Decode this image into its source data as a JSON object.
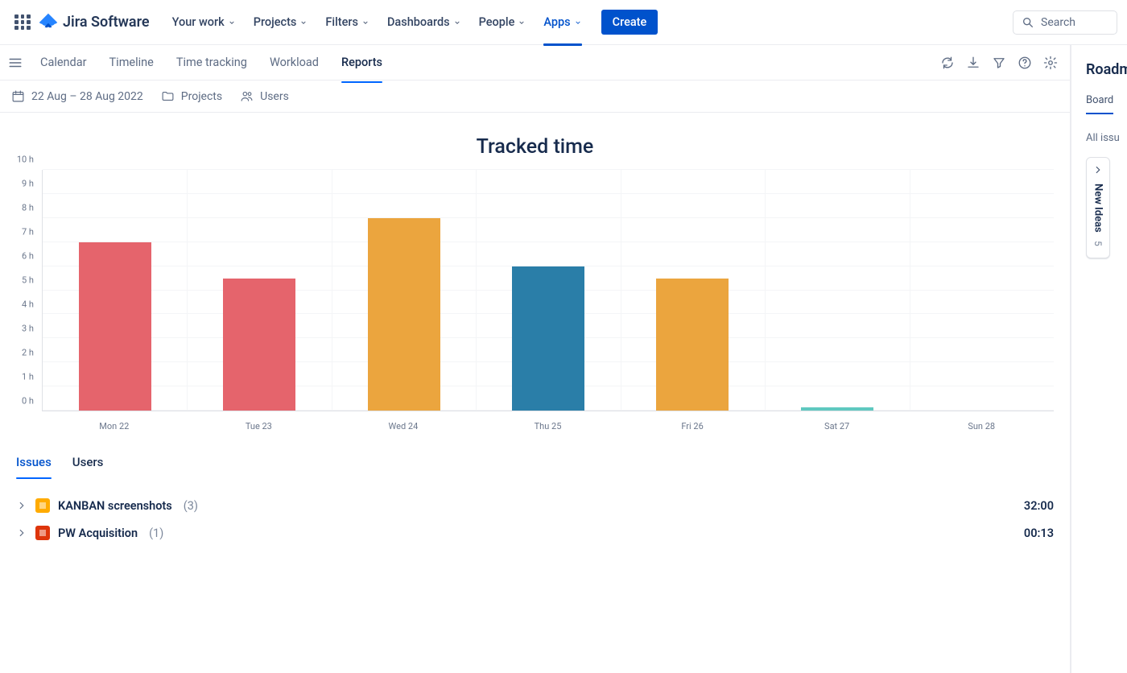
{
  "brand": {
    "name": "Jira Software"
  },
  "topnav": {
    "items": [
      {
        "label": "Your work"
      },
      {
        "label": "Projects"
      },
      {
        "label": "Filters"
      },
      {
        "label": "Dashboards"
      },
      {
        "label": "People"
      },
      {
        "label": "Apps",
        "selected": true
      }
    ],
    "create": "Create",
    "search_placeholder": "Search"
  },
  "subtabs": {
    "items": [
      {
        "label": "Calendar"
      },
      {
        "label": "Timeline"
      },
      {
        "label": "Time tracking"
      },
      {
        "label": "Workload"
      },
      {
        "label": "Reports",
        "active": true
      }
    ]
  },
  "filterbar": {
    "date_range": "22 Aug – 28 Aug 2022",
    "projects": "Projects",
    "users": "Users"
  },
  "chart_data": {
    "type": "bar",
    "title": "Tracked time",
    "ylabel": "",
    "ylim": [
      0,
      10
    ],
    "y_ticks": [
      "0 h",
      "1 h",
      "2 h",
      "3 h",
      "4 h",
      "5 h",
      "6 h",
      "7 h",
      "8 h",
      "9 h",
      "10 h"
    ],
    "categories": [
      "Mon 22",
      "Tue 23",
      "Wed 24",
      "Thu 25",
      "Fri 26",
      "Sat 27",
      "Sun 28"
    ],
    "values": [
      7,
      5.5,
      8,
      6,
      5.5,
      0.15,
      0
    ],
    "colors": [
      "#E5646C",
      "#E5646C",
      "#EBA53E",
      "#2A7EA8",
      "#EBA53E",
      "#5FC8C0",
      "#5FC8C0"
    ]
  },
  "lower_tabs": [
    {
      "label": "Issues",
      "active": true
    },
    {
      "label": "Users"
    }
  ],
  "issues": [
    {
      "icon_bg": "#FFAB00",
      "name": "KANBAN screenshots",
      "count": "(3)",
      "time": "32:00"
    },
    {
      "icon_bg": "#DE350B",
      "name": "PW Acquisition",
      "count": "(1)",
      "time": "00:13"
    }
  ],
  "right_panel": {
    "title": "Roadm",
    "tab": "Board",
    "all": "All issu",
    "card_title": "New Ideas",
    "card_count": "5"
  }
}
